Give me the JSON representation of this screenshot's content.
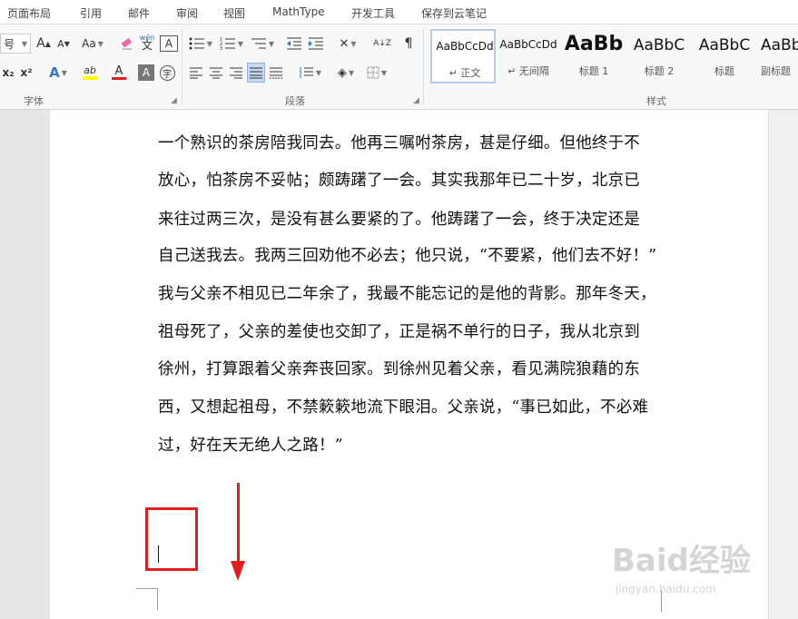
{
  "menubar": {
    "tabs": [
      "页面布局",
      "引用",
      "邮件",
      "审阅",
      "视图",
      "MathType",
      "开发工具",
      "保存到云笔记"
    ]
  },
  "ribbon": {
    "font_group": {
      "label": "字体",
      "font_size_value": "号",
      "grow_font": "A",
      "shrink_font": "A",
      "change_case": "Aa",
      "clear_format_icon": "eraser-icon",
      "phonetic_guide": "wén",
      "char_border": "A",
      "subscript": "x₂",
      "superscript": "x²",
      "text_effect": "A",
      "highlight": "ab",
      "font_color": "A",
      "char_shading": "A",
      "enclose_char": "字",
      "highlight_color": "#ffff00",
      "font_color_value": "#e11d1d"
    },
    "paragraph_group": {
      "label": "段落",
      "sort_label": "A↓Z"
    },
    "styles_group": {
      "label": "样式",
      "styles": [
        {
          "sample": "AaBbCcDd",
          "name": "↵ 正文",
          "selected": true
        },
        {
          "sample": "AaBbCcDd",
          "name": "↵ 无间隔",
          "selected": false
        },
        {
          "sample": "AaBb",
          "name": "标题 1",
          "selected": false
        },
        {
          "sample": "AaBbC",
          "name": "标题 2",
          "selected": false
        },
        {
          "sample": "AaBbC",
          "name": "标题",
          "selected": false
        },
        {
          "sample": "AaBb",
          "name": "副标题",
          "selected": false
        }
      ]
    }
  },
  "document": {
    "lines": [
      "一个熟识的茶房陪我同去。他再三嘱咐茶房，甚是仔细。但他终于不",
      "放心，怕茶房不妥帖；颇踌躇了一会。其实我那年已二十岁，北京已",
      "来往过两三次，是没有甚么要紧的了。他踌躇了一会，终于决定还是",
      "自己送我去。我两三回劝他不必去；他只说，“不要紧，他们去不好！”",
      "我与父亲不相见已二年余了，我最不能忘记的是他的背影。那年冬天，",
      "祖母死了，父亲的差使也交卸了，正是祸不单行的日子，我从北京到",
      "徐州，打算跟着父亲奔丧回家。到徐州见着父亲，看见满院狼藉的东",
      "西，又想起祖母，不禁簌簌地流下眼泪。父亲说，“事已如此，不必难",
      "过，好在天无绝人之路！”"
    ]
  },
  "annotations": {
    "box_color": "#e11d1d",
    "arrow_color": "#e11d1d"
  },
  "watermark": {
    "text": "Baid经验",
    "sub": "jingyan.baidu.com"
  }
}
